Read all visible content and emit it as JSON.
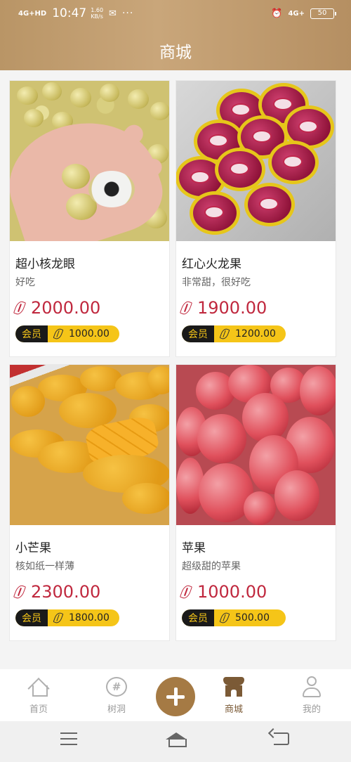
{
  "status": {
    "signal": "4G+HD",
    "time": "10:47",
    "speed_value": "1.60",
    "speed_unit": "KB/s",
    "network": "4G+",
    "battery": "50"
  },
  "header": {
    "title": "商城"
  },
  "products": [
    {
      "name": "超小核龙眼",
      "desc": "好吃",
      "price": "2000.00",
      "member_label": "会员",
      "member_price": "1000.00",
      "image": "longan"
    },
    {
      "name": "红心火龙果",
      "desc": "非常甜，很好吃",
      "price": "1900.00",
      "member_label": "会员",
      "member_price": "1200.00",
      "image": "dragon-fruit"
    },
    {
      "name": "小芒果",
      "desc": "核如纸一样薄",
      "price": "2300.00",
      "member_label": "会员",
      "member_price": "1800.00",
      "image": "mango"
    },
    {
      "name": "苹果",
      "desc": "超级甜的苹果",
      "price": "1000.00",
      "member_label": "会员",
      "member_price": "500.00",
      "image": "apple"
    }
  ],
  "tabbar": {
    "home": "首页",
    "treehole": "树洞",
    "shop": "商城",
    "mine": "我的",
    "active_color": "#7b5a36",
    "accent_color": "#a57a44"
  },
  "colors": {
    "price": "#c0283e",
    "member_badge": "#f5c518",
    "header": "#c09a6b"
  }
}
